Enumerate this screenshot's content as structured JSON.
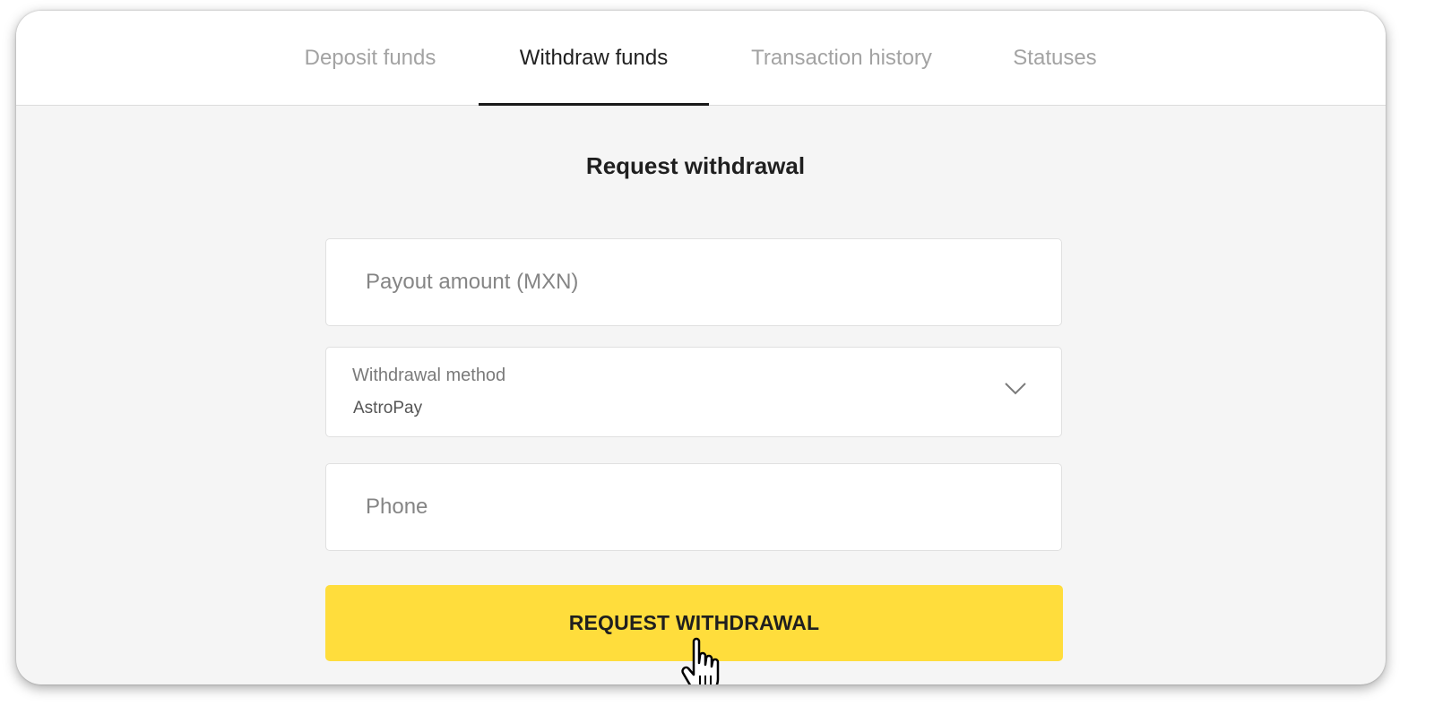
{
  "tabs": [
    {
      "label": "Deposit funds",
      "active": false
    },
    {
      "label": "Withdraw funds",
      "active": true
    },
    {
      "label": "Transaction history",
      "active": false
    },
    {
      "label": "Statuses",
      "active": false
    }
  ],
  "form": {
    "title": "Request withdrawal",
    "amount": {
      "placeholder": "Payout amount (MXN)",
      "value": ""
    },
    "method": {
      "label": "Withdrawal method",
      "value": "AstroPay",
      "icon": "chevron-down-icon"
    },
    "phone": {
      "placeholder": "Phone",
      "value": ""
    },
    "submit_label": "REQUEST WITHDRAWAL"
  },
  "colors": {
    "accent": "#ffdd3c",
    "background": "#f5f5f5",
    "active_tab_underline": "#1a1a1a"
  },
  "cursor": {
    "icon": "hand-pointer-cursor-icon"
  }
}
